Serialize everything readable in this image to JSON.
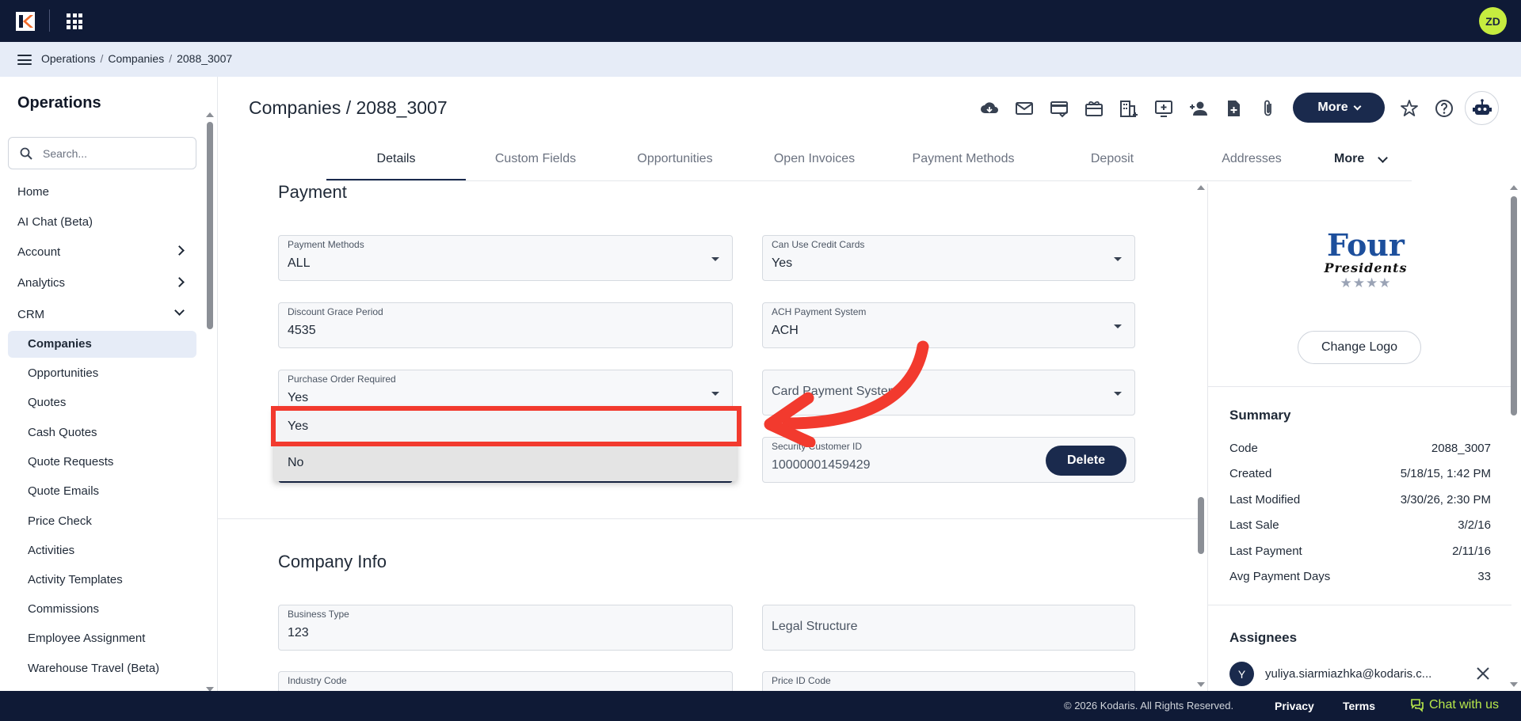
{
  "breadcrumb": [
    "Operations",
    "Companies",
    "2088_3007"
  ],
  "topbar": {
    "avatar_initials": "ZD"
  },
  "sidebar": {
    "title": "Operations",
    "search_placeholder": "Search...",
    "items": [
      {
        "label": "Home"
      },
      {
        "label": "AI Chat (Beta)"
      },
      {
        "label": "Account"
      },
      {
        "label": "Analytics"
      },
      {
        "label": "CRM"
      }
    ],
    "crm_items": [
      {
        "label": "Companies"
      },
      {
        "label": "Opportunities"
      },
      {
        "label": "Quotes"
      },
      {
        "label": "Cash Quotes"
      },
      {
        "label": "Quote Requests"
      },
      {
        "label": "Quote Emails"
      },
      {
        "label": "Price Check"
      },
      {
        "label": "Activities"
      },
      {
        "label": "Activity Templates"
      },
      {
        "label": "Commissions"
      },
      {
        "label": "Employee Assignment"
      },
      {
        "label": "Warehouse Travel (Beta)"
      }
    ]
  },
  "header": {
    "title": "Companies / 2088_3007",
    "more_label": "More"
  },
  "tabs": [
    "Details",
    "Custom Fields",
    "Opportunities",
    "Open Invoices",
    "Payment Methods",
    "Deposit",
    "Addresses"
  ],
  "tabs_more": "More",
  "payment": {
    "section_title": "Payment",
    "payment_methods": {
      "label": "Payment Methods",
      "value": "ALL"
    },
    "can_use_credit_cards": {
      "label": "Can Use Credit Cards",
      "value": "Yes"
    },
    "discount_grace_period": {
      "label": "Discount Grace Period",
      "value": "4535"
    },
    "ach_payment_system": {
      "label": "ACH Payment System",
      "value": "ACH"
    },
    "purchase_order_required": {
      "label": "Purchase Order Required",
      "value": "Yes"
    },
    "card_payment_system": {
      "placeholder": "Card Payment System"
    },
    "security_customer_id": {
      "label": "Security Customer ID",
      "value": "10000001459429"
    },
    "delete_label": "Delete"
  },
  "dropdown_options": [
    "Yes",
    "No"
  ],
  "company_info": {
    "section_title": "Company Info",
    "business_type": {
      "label": "Business Type",
      "value": "123"
    },
    "legal_structure": {
      "placeholder": "Legal Structure"
    },
    "industry_code": {
      "label": "Industry Code"
    },
    "price_id_code": {
      "label": "Price ID Code"
    }
  },
  "right_panel": {
    "logo_text_top": "Four",
    "logo_text_bottom": "Presidents",
    "logo_stars": "★★★★",
    "change_logo": "Change Logo",
    "summary_title": "Summary",
    "summary": [
      {
        "label": "Code",
        "value": "2088_3007"
      },
      {
        "label": "Created",
        "value": "5/18/15, 1:42 PM"
      },
      {
        "label": "Last Modified",
        "value": "3/30/26, 2:30 PM"
      },
      {
        "label": "Last Sale",
        "value": "3/2/16"
      },
      {
        "label": "Last Payment",
        "value": "2/11/16"
      },
      {
        "label": "Avg Payment Days",
        "value": "33"
      }
    ],
    "assignees_title": "Assignees",
    "assignee_initial": "Y",
    "assignee_email": "yuliya.siarmiazhka@kodaris.c..."
  },
  "footer": {
    "copyright": "© 2026 Kodaris. All Rights Reserved.",
    "privacy": "Privacy",
    "terms": "Terms",
    "chat": "Chat with us"
  },
  "colors": {
    "navy": "#0f1a36",
    "button_navy": "#1a2a4d",
    "accent_green": "#c6ec3f",
    "annotation_red": "#f23a2e",
    "crumb_bg": "#e6ecf7"
  }
}
